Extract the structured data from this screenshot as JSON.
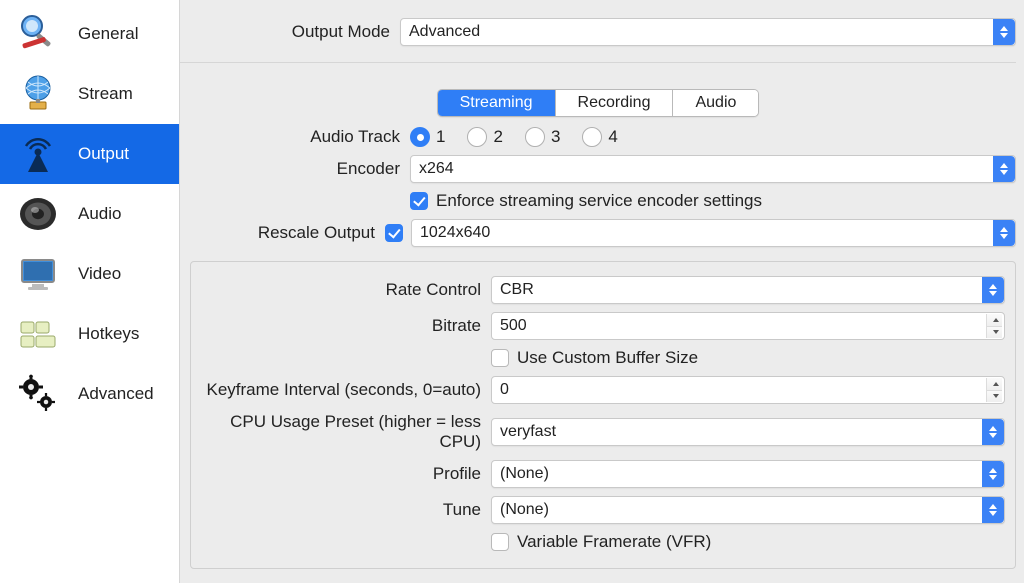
{
  "sidebar": {
    "items": [
      {
        "label": "General"
      },
      {
        "label": "Stream"
      },
      {
        "label": "Output"
      },
      {
        "label": "Audio"
      },
      {
        "label": "Video"
      },
      {
        "label": "Hotkeys"
      },
      {
        "label": "Advanced"
      }
    ]
  },
  "header": {
    "output_mode_label": "Output Mode",
    "output_mode_value": "Advanced"
  },
  "tabs": {
    "streaming": "Streaming",
    "recording": "Recording",
    "audio": "Audio"
  },
  "streaming": {
    "audio_track_label": "Audio Track",
    "audio_track_options": [
      "1",
      "2",
      "3",
      "4"
    ],
    "audio_track_selected": "1",
    "encoder_label": "Encoder",
    "encoder_value": "x264",
    "enforce_label": "Enforce streaming service encoder settings",
    "enforce_checked": true,
    "rescale_label": "Rescale Output",
    "rescale_checked": true,
    "rescale_value": "1024x640"
  },
  "encoder_settings": {
    "rate_control_label": "Rate Control",
    "rate_control_value": "CBR",
    "bitrate_label": "Bitrate",
    "bitrate_value": "500",
    "custom_buffer_label": "Use Custom Buffer Size",
    "custom_buffer_checked": false,
    "keyframe_label": "Keyframe Interval (seconds, 0=auto)",
    "keyframe_value": "0",
    "cpu_preset_label": "CPU Usage Preset (higher = less CPU)",
    "cpu_preset_value": "veryfast",
    "profile_label": "Profile",
    "profile_value": "(None)",
    "tune_label": "Tune",
    "tune_value": "(None)",
    "vfr_label": "Variable Framerate (VFR)",
    "vfr_checked": false
  }
}
